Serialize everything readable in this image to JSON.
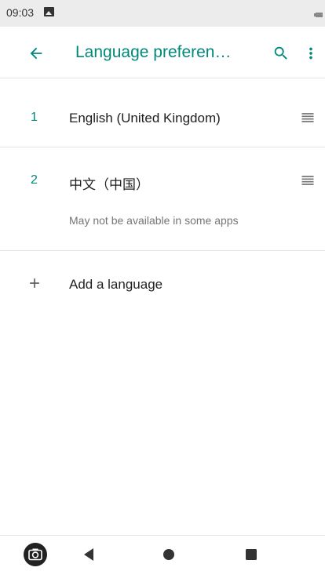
{
  "status_bar": {
    "time": "09:03"
  },
  "app_bar": {
    "title": "Language preferen…"
  },
  "languages": [
    {
      "index": "1",
      "name": "English (United Kingdom)",
      "note": ""
    },
    {
      "index": "2",
      "name": "中文（中国）",
      "note": "May not be available in some apps"
    }
  ],
  "add_language": {
    "label": "Add a language"
  },
  "icons": {
    "back": "back-arrow-icon",
    "search": "search-icon",
    "more": "more-vert-icon",
    "drag": "drag-handle-icon",
    "add": "plus-icon",
    "camera": "camera-icon",
    "nav_back": "nav-back-icon",
    "nav_home": "nav-home-icon",
    "nav_recents": "nav-recents-icon"
  },
  "colors": {
    "accent": "#00897b",
    "status_bar": "#ececec",
    "divider": "#e4e4e4",
    "secondary_text": "#757575"
  }
}
